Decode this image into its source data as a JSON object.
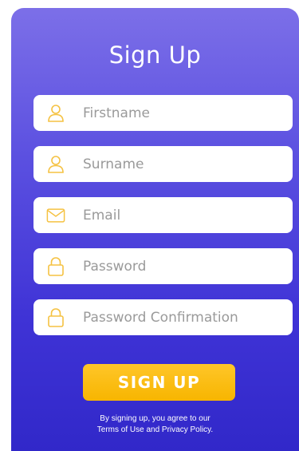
{
  "form": {
    "title": "Sign Up",
    "fields": [
      {
        "icon": "user-icon",
        "placeholder": "Firstname",
        "value": ""
      },
      {
        "icon": "user-icon",
        "placeholder": "Surname",
        "value": ""
      },
      {
        "icon": "mail-icon",
        "placeholder": "Email",
        "value": ""
      },
      {
        "icon": "lock-icon",
        "placeholder": "Password",
        "value": ""
      },
      {
        "icon": "lock-icon",
        "placeholder": "Password Confirmation",
        "value": ""
      }
    ],
    "submit_label": "SIGN UP",
    "terms_line1": "By signing up, you agree to our",
    "terms_line2": "Terms of Use and Privacy Policy."
  },
  "colors": {
    "gradient_top": "#7c6fe8",
    "gradient_bottom": "#3128c9",
    "icon": "#f5c242",
    "button": "#f7b500",
    "placeholder": "#9a9a9a"
  }
}
